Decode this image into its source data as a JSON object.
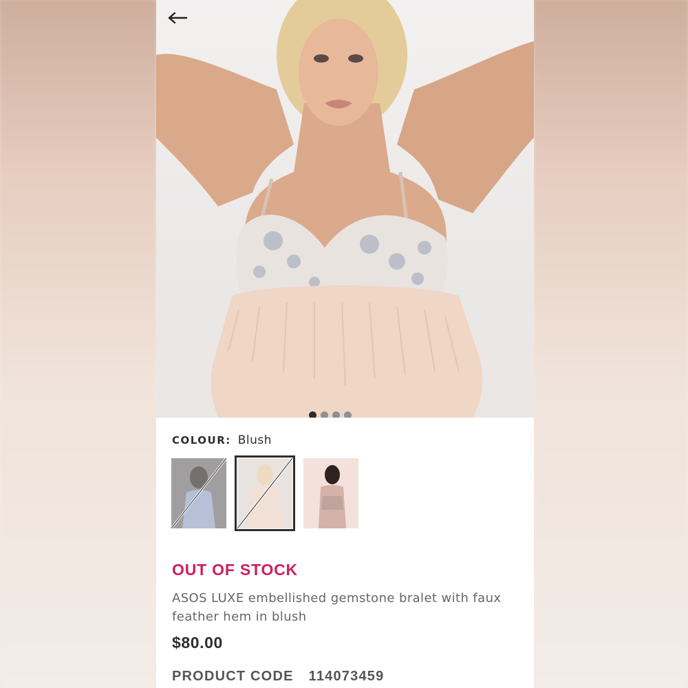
{
  "product": {
    "colour_label": "COLOUR:",
    "colour_value": "Blush",
    "stock_status": "OUT OF STOCK",
    "title": "ASOS LUXE embellished gemstone bralet with faux feather hem in blush",
    "price": "$80.00",
    "product_code_label": "PRODUCT CODE",
    "product_code": "114073459"
  },
  "gallery": {
    "image_count": 4,
    "active_index": 0
  },
  "swatches": [
    {
      "name": "blue variant",
      "state": "unavailable"
    },
    {
      "name": "blush variant",
      "state": "selected-unavailable"
    },
    {
      "name": "pink variant",
      "state": "available"
    }
  ],
  "icons": {
    "back": "arrow-left-icon"
  },
  "colors": {
    "accent_out_of_stock": "#cc1f5b",
    "text_primary": "#2d2d2d",
    "text_secondary": "#666666"
  }
}
